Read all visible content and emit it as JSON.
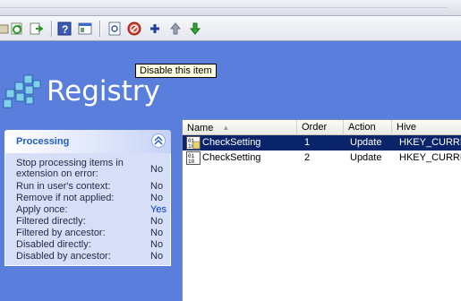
{
  "toolbar": {
    "buttons": [
      {
        "icon": "back-icon"
      },
      {
        "icon": "refresh-icon"
      },
      {
        "icon": "export-icon"
      },
      {
        "icon": "help-icon"
      },
      {
        "icon": "view-icon"
      },
      {
        "icon": "properties-icon"
      },
      {
        "icon": "disable-icon"
      },
      {
        "icon": "add-icon"
      },
      {
        "icon": "move-up-icon"
      },
      {
        "icon": "move-down-icon"
      }
    ]
  },
  "tooltip": {
    "text": "Disable this item"
  },
  "header": {
    "title": "Registry"
  },
  "processing": {
    "title": "Processing",
    "rows": [
      {
        "label": "Stop processing items in extension on error:",
        "value": "No"
      },
      {
        "label": "Run in user's context:",
        "value": "No"
      },
      {
        "label": "Remove if not applied:",
        "value": "No"
      },
      {
        "label": "Apply once:",
        "value": "Yes"
      },
      {
        "label": "Filtered directly:",
        "value": "No"
      },
      {
        "label": "Filtered by ancestor:",
        "value": "No"
      },
      {
        "label": "Disabled directly:",
        "value": "No"
      },
      {
        "label": "Disabled by ancestor:",
        "value": "No"
      }
    ]
  },
  "list": {
    "columns": [
      "Name",
      "Order",
      "Action",
      "Hive"
    ],
    "rows": [
      {
        "name": "CheckSetting",
        "order": "1",
        "action": "Update",
        "hive": "HKEY_CURRE",
        "selected": true
      },
      {
        "name": "CheckSetting",
        "order": "2",
        "action": "Update",
        "hive": "HKEY_CURRE",
        "selected": false
      }
    ]
  },
  "colors": {
    "background": "#5a7edc",
    "selection": "#0a246a",
    "taskpane_title": "#215dc6"
  }
}
